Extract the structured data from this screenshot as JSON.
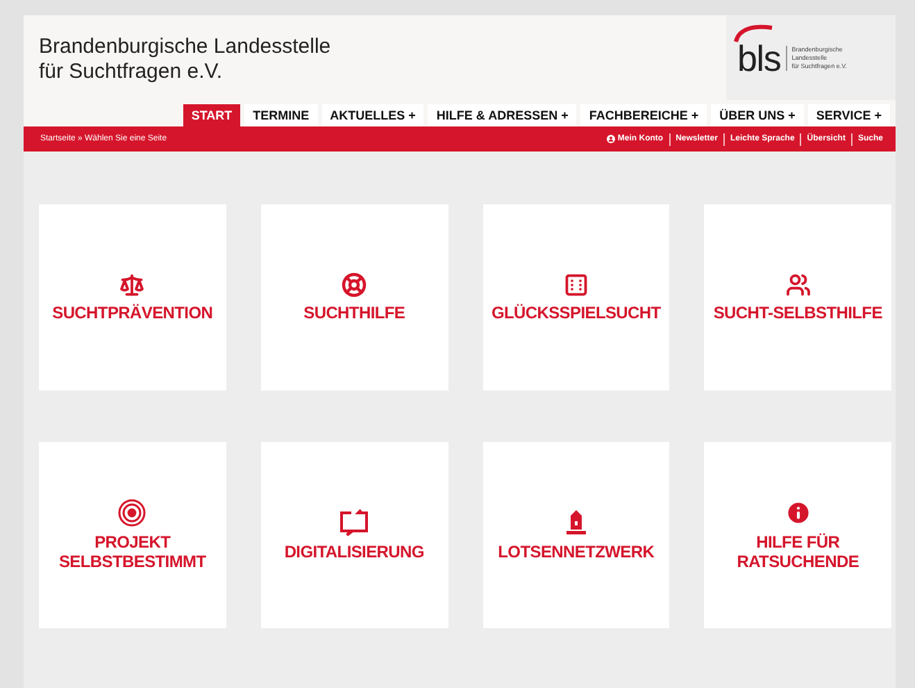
{
  "header": {
    "title_lines": [
      "Brandenburgische Landesstelle",
      "für Suchtfragen e.V."
    ],
    "logo": {
      "mark": "bls",
      "lines": [
        "Brandenburgische",
        "Landesstelle",
        "für Suchtfragen e.V."
      ]
    }
  },
  "nav": [
    {
      "label": "START",
      "selected": true
    },
    {
      "label": "TERMINE",
      "selected": false
    },
    {
      "label": "AKTUELLES +",
      "selected": false
    },
    {
      "label": "HILFE & ADRESSEN +",
      "selected": false
    },
    {
      "label": "FACHBEREICHE +",
      "selected": false
    },
    {
      "label": "ÜBER UNS +",
      "selected": false
    },
    {
      "label": "SERVICE +",
      "selected": false
    }
  ],
  "breadcrumb": "Startseite » Wählen Sie eine Seite",
  "service_links": [
    {
      "label": "Mein Konto",
      "kind": "account"
    },
    {
      "label": "Newsletter",
      "kind": "plain"
    },
    {
      "label": "Leichte Sprache",
      "kind": "plain"
    },
    {
      "label": "Übersicht",
      "kind": "plain"
    },
    {
      "label": "Suche",
      "kind": "plain"
    }
  ],
  "tiles": [
    {
      "lines": [
        "SUCHTPRÄVENTION"
      ]
    },
    {
      "lines": [
        "SUCHTHILFE"
      ]
    },
    {
      "lines": [
        "GLÜCKSSPIELSUCHT"
      ]
    },
    {
      "lines": [
        "SUCHT-SELBSTHILFE"
      ]
    },
    {
      "lines": [
        "PROJEKT",
        "SELBSTBESTIMMT"
      ]
    },
    {
      "lines": [
        "DIGITALISIERUNG"
      ]
    },
    {
      "lines": [
        "LOTSENNETZWERK"
      ]
    },
    {
      "lines": [
        "HILFE FÜR",
        "RATSUCHENDE"
      ]
    }
  ]
}
